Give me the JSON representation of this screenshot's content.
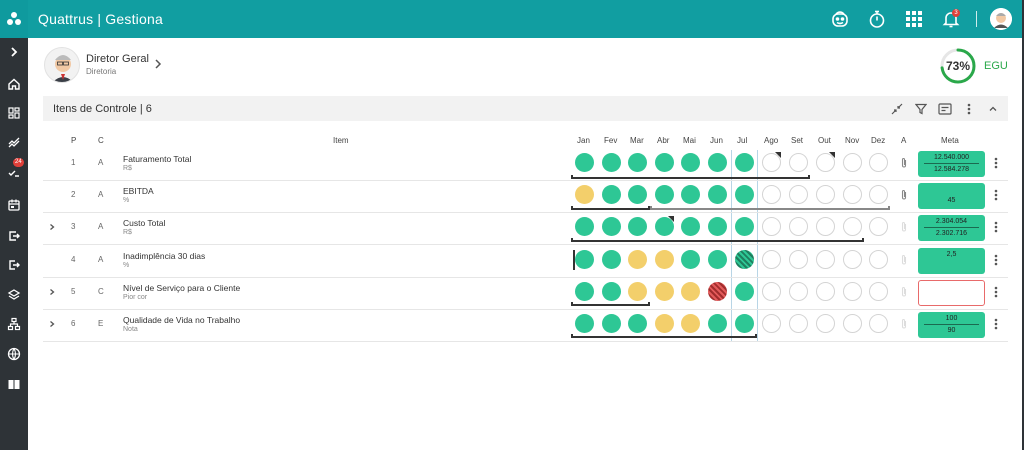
{
  "app": {
    "title": "Quattrus | Gestiona"
  },
  "sidebar": {
    "items": [
      {
        "icon": "chevron-right-icon",
        "badge": ""
      },
      {
        "icon": "home-icon",
        "badge": ""
      },
      {
        "icon": "dashboard-icon",
        "badge": ""
      },
      {
        "icon": "trend-icon",
        "badge": ""
      },
      {
        "icon": "checklist-icon",
        "badge": "24"
      },
      {
        "icon": "calendar-icon",
        "badge": ""
      },
      {
        "icon": "export-icon",
        "badge": ""
      },
      {
        "icon": "logout-icon",
        "badge": ""
      },
      {
        "icon": "layers-icon",
        "badge": ""
      },
      {
        "icon": "org-chart-icon",
        "badge": ""
      },
      {
        "icon": "globe-icon",
        "badge": ""
      },
      {
        "icon": "book-icon",
        "badge": ""
      }
    ]
  },
  "topbar": {
    "notification_count": "3"
  },
  "user": {
    "name": "Diretor Geral",
    "department": "Diretoria"
  },
  "egu": {
    "percent": "73%",
    "value": 0.73,
    "label": "EGU",
    "color": "#2aa84a"
  },
  "section": {
    "title": "Itens de Controle | 6"
  },
  "table": {
    "headers": {
      "p": "P",
      "c": "C",
      "item": "Item",
      "a": "A",
      "meta": "Meta"
    },
    "months": [
      "Jan",
      "Fev",
      "Mar",
      "Abr",
      "Mai",
      "Jun",
      "Jul",
      "Ago",
      "Set",
      "Out",
      "Nov",
      "Dez"
    ],
    "rows": [
      {
        "expandable": false,
        "p": "1",
        "c": "A",
        "name": "Faturamento Total",
        "unit": "R$",
        "status": [
          "green",
          "green",
          "green",
          "green",
          "green",
          "green",
          "green",
          "empty",
          "empty",
          "empty",
          "empty",
          "empty"
        ],
        "flags": [
          7,
          9
        ],
        "meta": [
          "12.540.000",
          "12.584.278"
        ]
      },
      {
        "expandable": false,
        "p": "2",
        "c": "A",
        "name": "EBITDA",
        "unit": "%",
        "status": [
          "yellow",
          "green",
          "green",
          "green",
          "green",
          "green",
          "green",
          "empty",
          "empty",
          "empty",
          "empty",
          "empty"
        ],
        "flags": [],
        "meta": [
          "",
          "45"
        ]
      },
      {
        "expandable": true,
        "p": "3",
        "c": "A",
        "name": "Custo Total",
        "unit": "R$",
        "status": [
          "green",
          "green",
          "green",
          "green",
          "green",
          "green",
          "green",
          "empty",
          "empty",
          "empty",
          "empty",
          "empty"
        ],
        "flags": [
          3
        ],
        "meta": [
          "2.304.054",
          "2.302.716"
        ]
      },
      {
        "expandable": false,
        "p": "4",
        "c": "A",
        "name": "Inadimplência 30 dias",
        "unit": "%",
        "status": [
          "green",
          "green",
          "yellow",
          "yellow",
          "green",
          "green",
          "hatch-green",
          "empty",
          "empty",
          "empty",
          "empty",
          "empty"
        ],
        "flags": [],
        "meta": [
          "2,5",
          ""
        ]
      },
      {
        "expandable": true,
        "p": "5",
        "c": "C",
        "name": "Nível de Serviço para o Cliente",
        "unit": "Pior cor",
        "status": [
          "green",
          "green",
          "yellow",
          "yellow",
          "yellow",
          "hatch-red",
          "green",
          "empty",
          "empty",
          "empty",
          "empty",
          "empty"
        ],
        "flags": [],
        "meta": []
      },
      {
        "expandable": true,
        "p": "6",
        "c": "E",
        "name": "Qualidade de Vida no Trabalho",
        "unit": "Nota",
        "status": [
          "green",
          "green",
          "green",
          "yellow",
          "yellow",
          "green",
          "green",
          "empty",
          "empty",
          "empty",
          "empty",
          "empty"
        ],
        "flags": [],
        "meta": [
          "100",
          "90"
        ]
      }
    ]
  },
  "colors": {
    "topbar": "#119ea1",
    "sidebar": "#2e3337",
    "green": "#2ec795",
    "yellow": "#f3cf6b",
    "red": "#e35a5a"
  }
}
